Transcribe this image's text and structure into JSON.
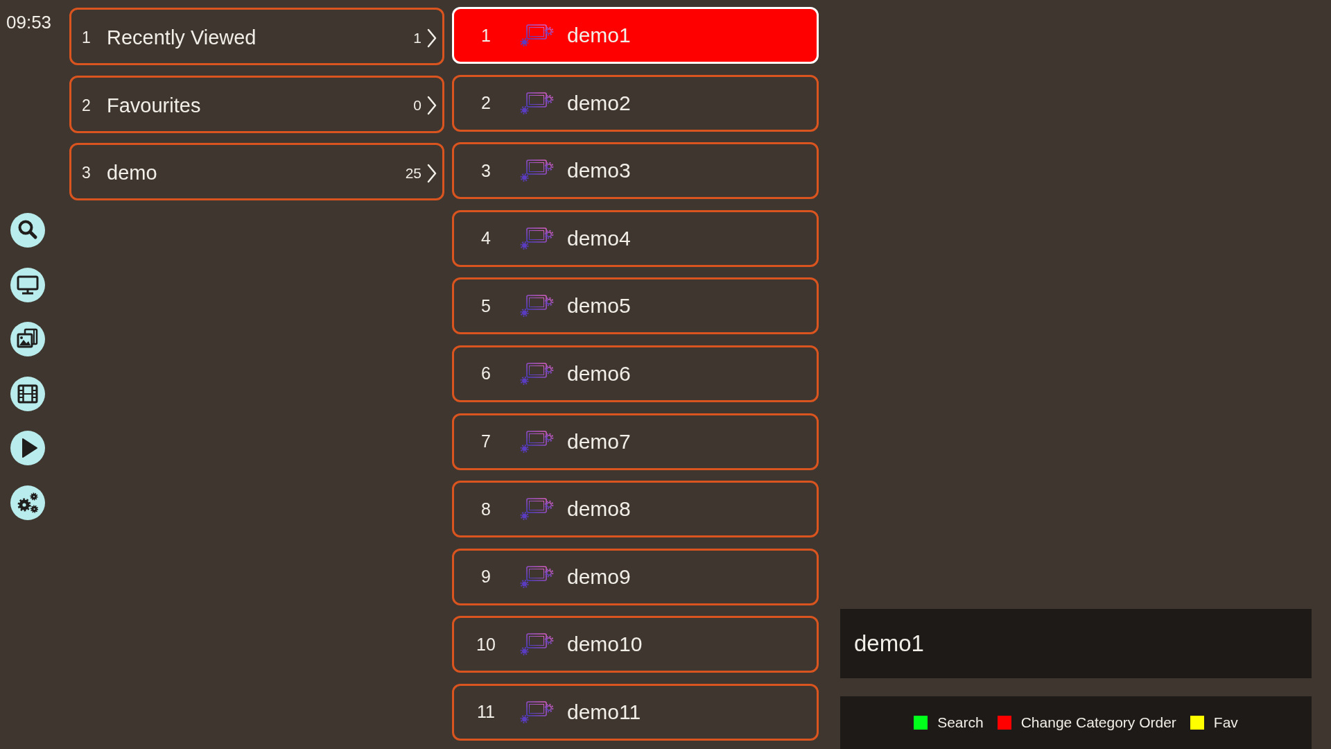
{
  "clock": "09:53",
  "categories": [
    {
      "number": "1",
      "name": "Recently Viewed",
      "count": "1",
      "selected": false
    },
    {
      "number": "2",
      "name": "Favourites",
      "count": "0",
      "selected": false
    },
    {
      "number": "3",
      "name": "demo",
      "count": "25",
      "selected": false
    }
  ],
  "channels": [
    {
      "number": "1",
      "name": "demo1",
      "selected": true
    },
    {
      "number": "2",
      "name": "demo2",
      "selected": false
    },
    {
      "number": "3",
      "name": "demo3",
      "selected": false
    },
    {
      "number": "4",
      "name": "demo4",
      "selected": false
    },
    {
      "number": "5",
      "name": "demo5",
      "selected": false
    },
    {
      "number": "6",
      "name": "demo6",
      "selected": false
    },
    {
      "number": "7",
      "name": "demo7",
      "selected": false
    },
    {
      "number": "8",
      "name": "demo8",
      "selected": false
    },
    {
      "number": "9",
      "name": "demo9",
      "selected": false
    },
    {
      "number": "10",
      "name": "demo10",
      "selected": false
    },
    {
      "number": "11",
      "name": "demo11",
      "selected": false
    }
  ],
  "info_panel": {
    "title": "demo1"
  },
  "legend": [
    {
      "label": "Search",
      "color": "#00ff1a"
    },
    {
      "label": "Change Category Order",
      "color": "#ff0000"
    },
    {
      "label": "Fav",
      "color": "#ffff00"
    }
  ]
}
